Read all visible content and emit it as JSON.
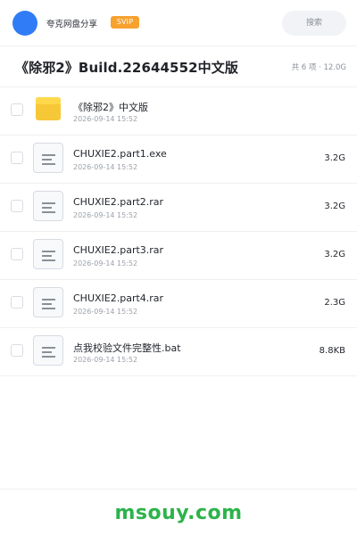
{
  "header": {
    "owner_name": "夸克网盘分享",
    "vip_label": "SVIP",
    "search_label": "搜索"
  },
  "folder": {
    "title": "《除邪2》Build.22644552中文版",
    "meta": "共 6 项 · 12.0G"
  },
  "files": [
    {
      "name": "《除邪2》中文版",
      "date": "2026-09-14 15:52",
      "size": "",
      "icon": "folder-icon"
    },
    {
      "name": "CHUXIE2.part1.exe",
      "date": "2026-09-14 15:52",
      "size": "3.2G",
      "icon": "file-icon"
    },
    {
      "name": "CHUXIE2.part2.rar",
      "date": "2026-09-14 15:52",
      "size": "3.2G",
      "icon": "file-icon"
    },
    {
      "name": "CHUXIE2.part3.rar",
      "date": "2026-09-14 15:52",
      "size": "3.2G",
      "icon": "file-icon"
    },
    {
      "name": "CHUXIE2.part4.rar",
      "date": "2026-09-14 15:52",
      "size": "2.3G",
      "icon": "file-icon"
    },
    {
      "name": "点我校验文件完整性.bat",
      "date": "2026-09-14 15:52",
      "size": "8.8KB",
      "icon": "file-icon"
    }
  ],
  "watermark": "msouy.com",
  "colors": {
    "accent": "#2f7cf6",
    "vip": "#f7a12f",
    "folder": "#f6c737",
    "watermark": "#2cb34a",
    "divider": "#eef0f3"
  }
}
